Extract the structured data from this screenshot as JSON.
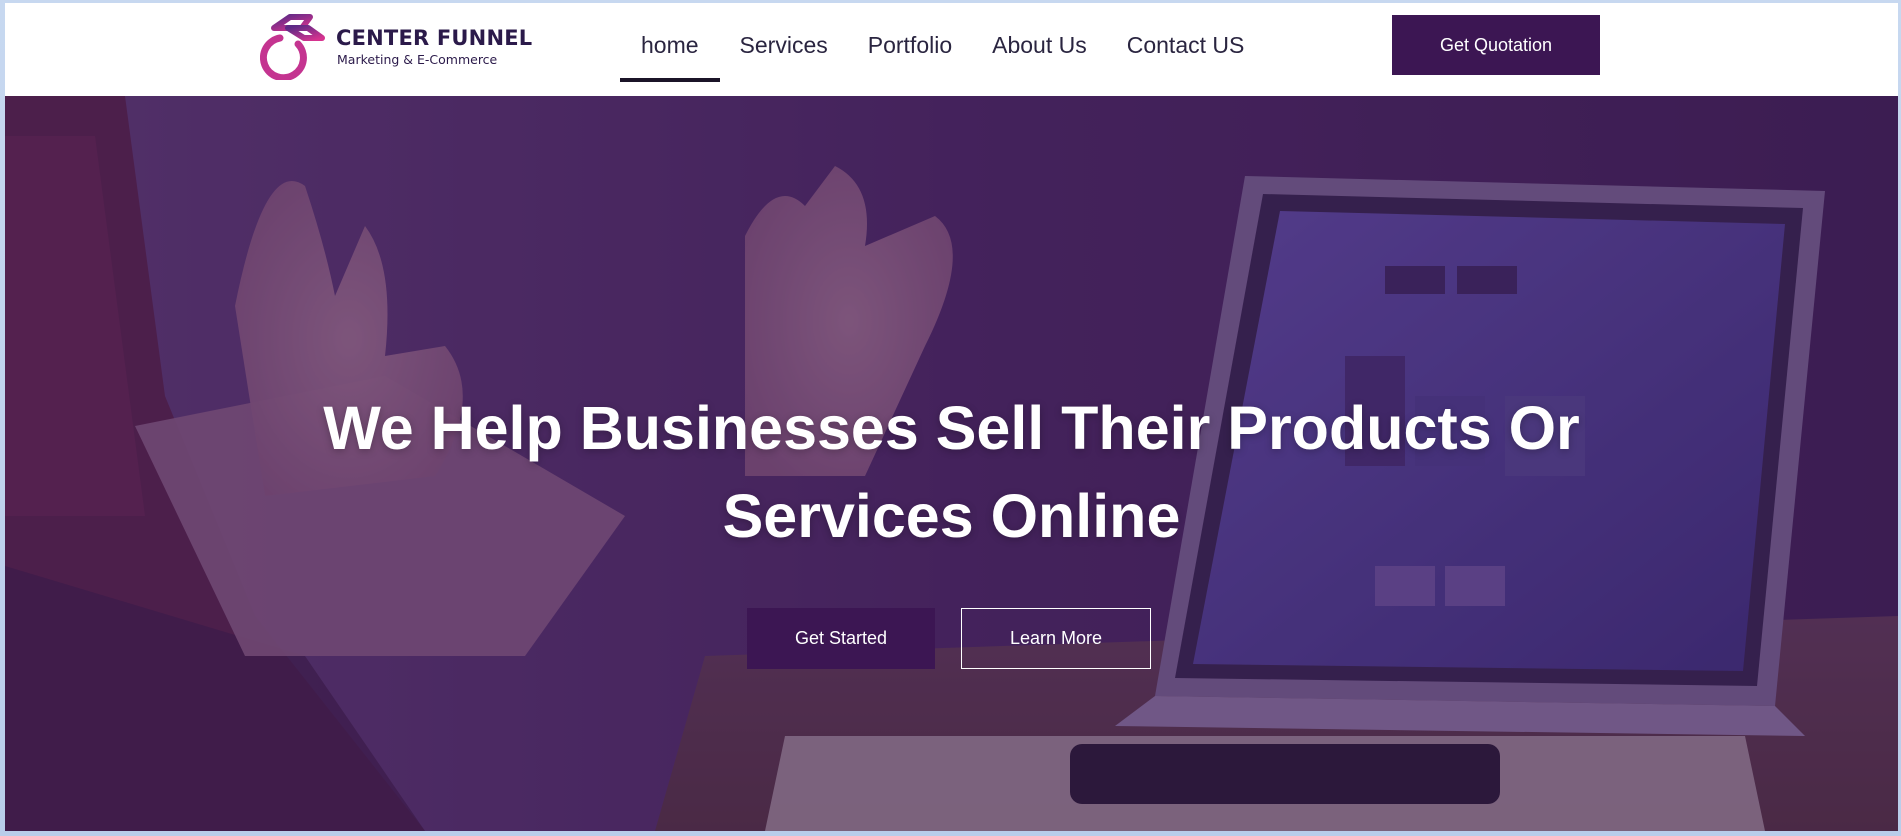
{
  "header": {
    "logo": {
      "name": "CENTER FUNNEL",
      "tagline": "Marketing & E-Commerce"
    },
    "nav": [
      {
        "label": "home",
        "active": true
      },
      {
        "label": "Services",
        "active": false
      },
      {
        "label": "Portfolio",
        "active": false
      },
      {
        "label": "About Us",
        "active": false
      },
      {
        "label": "Contact US",
        "active": false
      }
    ],
    "cta_label": "Get Quotation"
  },
  "hero": {
    "title_line1": "We Help Businesses Sell Their Products Or",
    "title_line2": "Services Online",
    "primary_button": "Get Started",
    "secondary_button": "Learn More"
  },
  "colors": {
    "brand": "#3c1653",
    "logo_gradient_start": "#5b2a86",
    "logo_gradient_end": "#d6338f",
    "text_dark": "#2a2540"
  }
}
